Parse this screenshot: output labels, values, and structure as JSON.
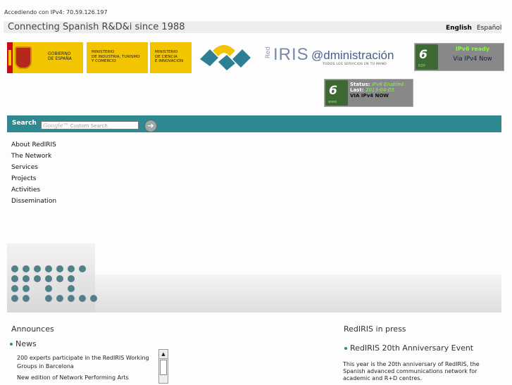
{
  "header": {
    "ip_text": "Accediendo con IPv4: 70.59.126.197",
    "tagline": "Connecting Spanish R&D&i since 1988",
    "lang_english": "English",
    "lang_spanish": "Español"
  },
  "logos": {
    "gobierno": "GOBIERNO\nDE ESPAÑA",
    "ministry1": "MINISTERIO\nDE INDUSTRIA, TURISMO\nY COMERCIO",
    "ministry2": "MINISTERIO\nDE CIENCIA\nE INNOVACIÓN",
    "rediris_red": "Red",
    "rediris": "IRIS",
    "admin": "@dministración",
    "admin_sub": "TODOS LOS SERVICIOS EN TU MANO"
  },
  "ipv6_badge": {
    "logo_text": "6",
    "logo_sub": "RDY",
    "status": "IPv6 ready",
    "via": "Via IPv4 Now"
  },
  "ipv6_status": {
    "logo_text": "6",
    "logo_sub": "www",
    "status_label": "Status:",
    "status_value": "IPv6 Enabled",
    "last_label": "Last:",
    "last_value": "2013-04-03",
    "via": "VIA IPv4 NOW"
  },
  "search": {
    "label": "Search",
    "google": "Google™",
    "placeholder": "Custom Search",
    "button": "➔"
  },
  "nav": [
    "About RedIRIS",
    "The Network",
    "Services",
    "Projects",
    "Activities",
    "Dissemination"
  ],
  "announces": {
    "title": "Announces",
    "news_title": "News",
    "items": [
      "200 experts participate in the RedIRIS Working Groups in Barcelona",
      "New edition of Network Performing Arts"
    ]
  },
  "press": {
    "title": "RedIRIS in press",
    "item_title": "RedIRIS 20th Anniversary Event",
    "item_text": "This year is the 20th anniversary of RedIRIS, the Spanish advanced communications network for academic and R+D centres."
  },
  "colors": {
    "accent": "#2e8a90",
    "gov_yellow": "#f2c500",
    "gov_red": "#c60b1e"
  }
}
